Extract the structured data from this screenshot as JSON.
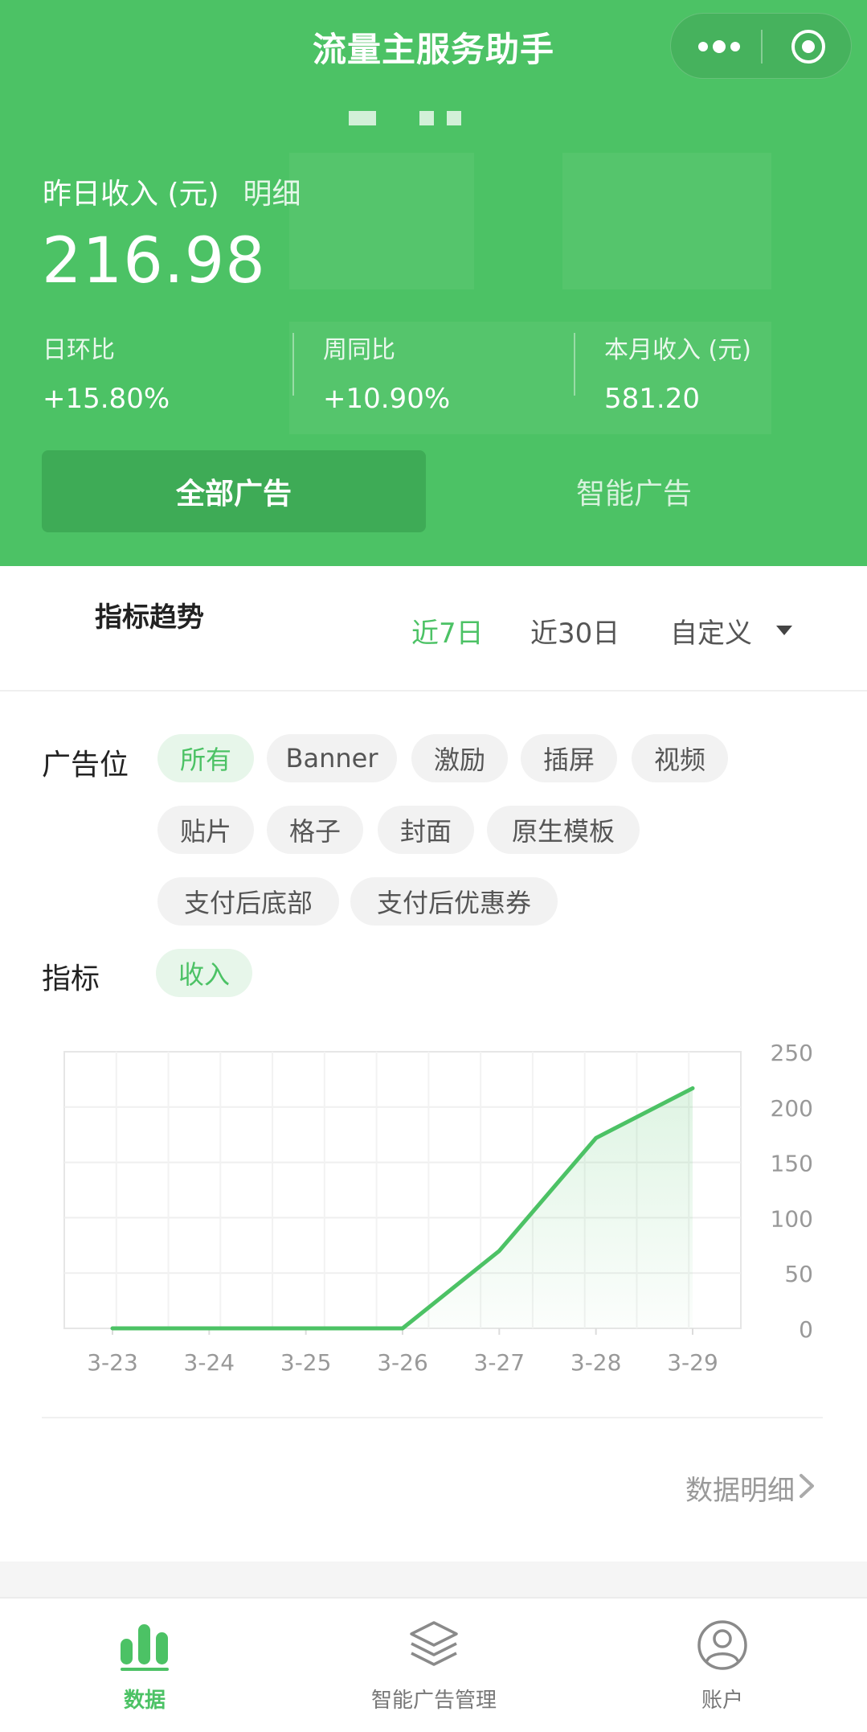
{
  "nav": {
    "title": "流量主服务助手",
    "more_icon": "more-dots-icon",
    "close_icon": "target-circle-icon"
  },
  "summary": {
    "label": "昨日收入 (元)",
    "detail_link": "明细",
    "value": "216.98",
    "stats": [
      {
        "key": "日环比",
        "value": "+15.80%"
      },
      {
        "key": "周同比",
        "value": "+10.90%"
      },
      {
        "key": "本月收入 (元)",
        "value": "581.20"
      }
    ]
  },
  "ad_tabs": [
    {
      "label": "全部广告",
      "active": true
    },
    {
      "label": "智能广告",
      "active": false
    }
  ],
  "trend": {
    "title": "指标趋势",
    "ranges": [
      {
        "label": "近7日",
        "active": true
      },
      {
        "label": "近30日",
        "active": false
      },
      {
        "label": "自定义",
        "active": false
      }
    ]
  },
  "filters": {
    "placement_label": "广告位",
    "placements": [
      "所有",
      "Banner",
      "激励",
      "插屏",
      "视频",
      "贴片",
      "格子",
      "封面",
      "原生模板",
      "支付后底部",
      "支付后优惠券"
    ],
    "selected_placement": "所有",
    "metric_label": "指标",
    "metrics": [
      "收入"
    ]
  },
  "chart_data": {
    "type": "area",
    "x": [
      "3-23",
      "3-24",
      "3-25",
      "3-26",
      "3-27",
      "3-28",
      "3-29"
    ],
    "series": [
      {
        "values": [
          0,
          0,
          0,
          0,
          70,
          172,
          216.98
        ]
      }
    ],
    "ylim": [
      0,
      250
    ],
    "yticks": [
      0,
      50,
      100,
      150,
      200,
      250
    ],
    "y_axis_side": "right",
    "grid": true,
    "color": "#4cc265"
  },
  "detail_footer": {
    "label": "数据明细"
  },
  "tabbar": [
    {
      "label": "数据",
      "icon": "bar-chart-icon",
      "active": true
    },
    {
      "label": "智能广告管理",
      "icon": "layers-icon",
      "active": false
    },
    {
      "label": "账户",
      "icon": "user-circle-icon",
      "active": false
    }
  ],
  "colors": {
    "brand": "#4cc265",
    "brand_dark": "#3eab56",
    "chip_bg": "#f2f2f2",
    "chip_selected_bg": "#e7f6ea"
  }
}
